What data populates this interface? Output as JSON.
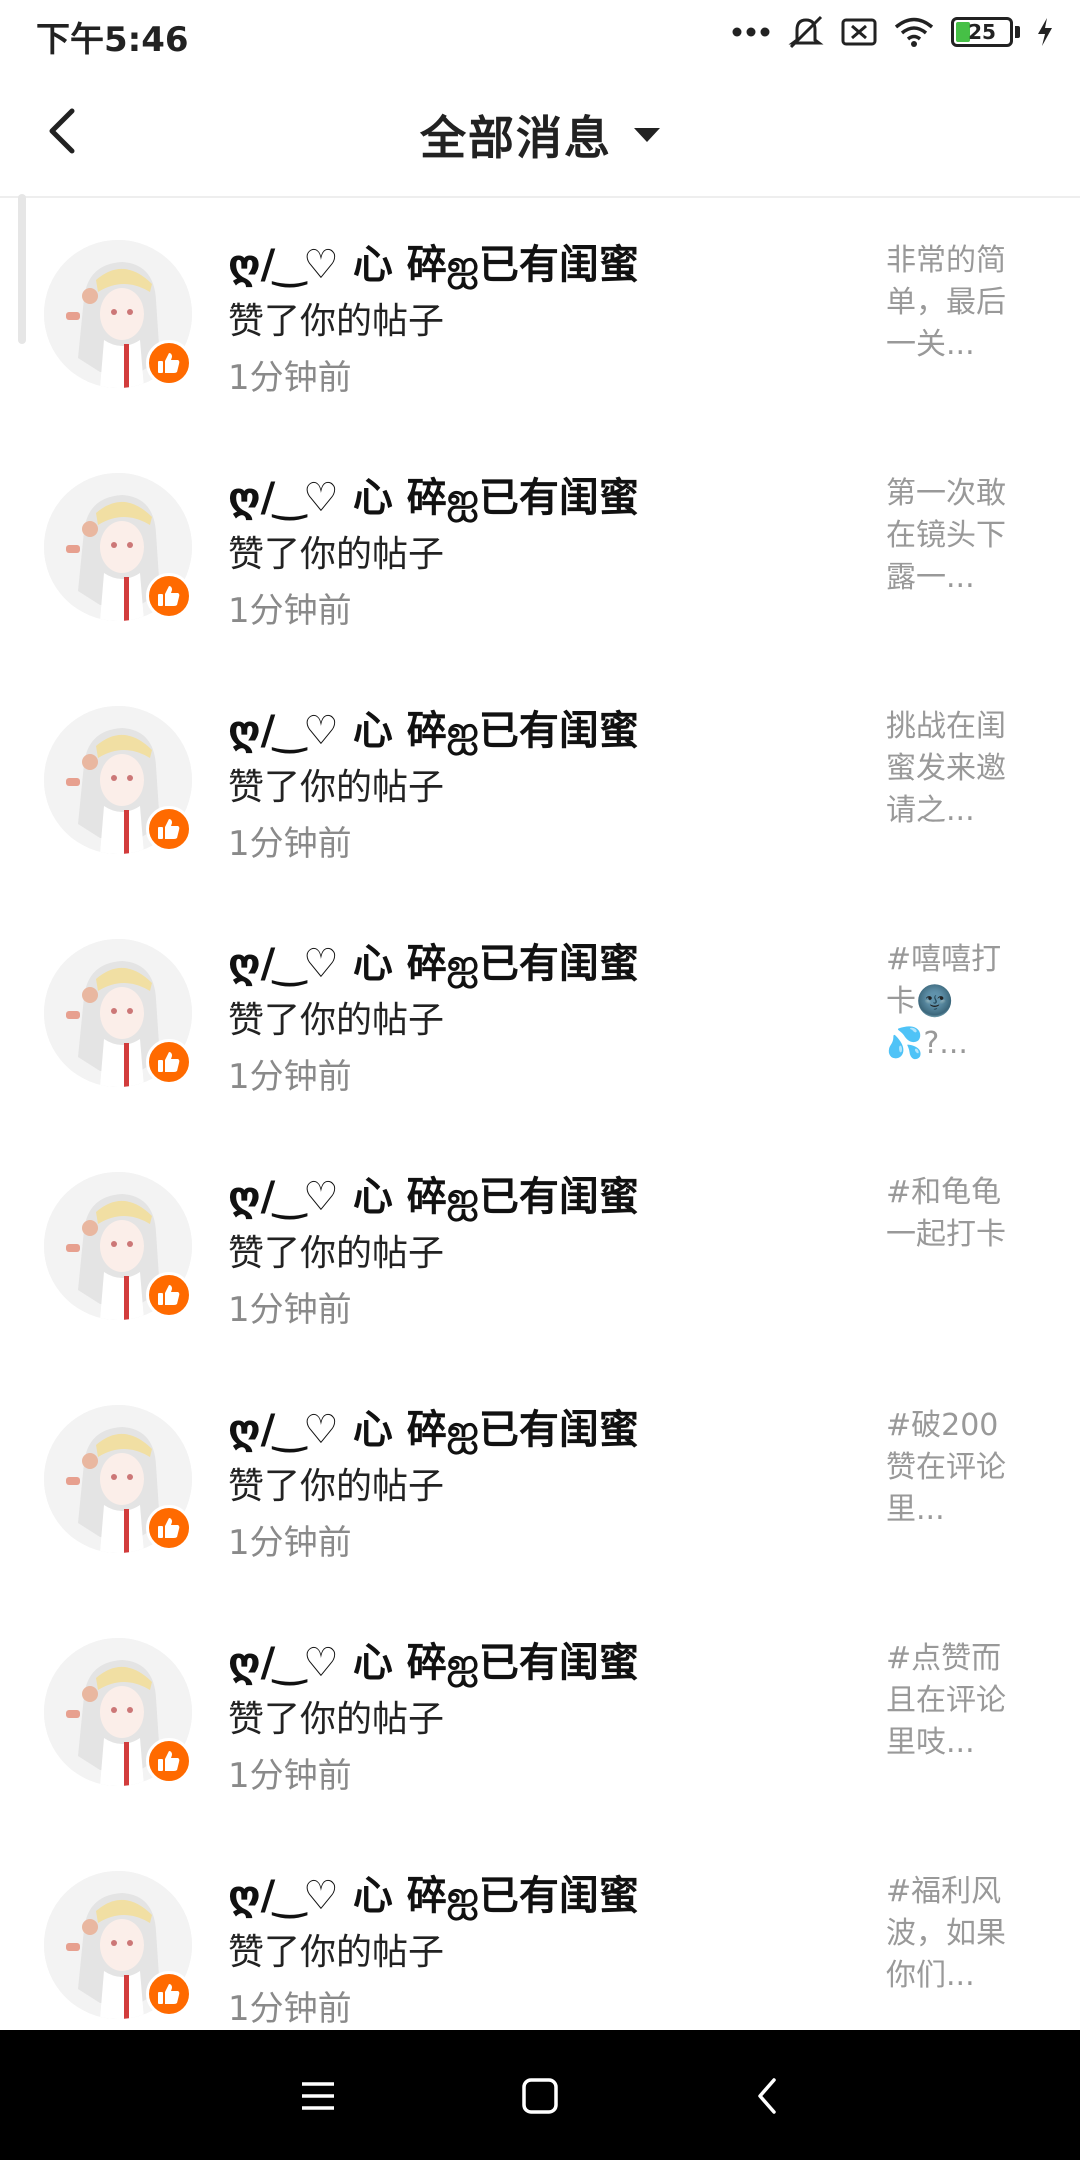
{
  "status_bar": {
    "time": "下午5:46",
    "battery": "25",
    "battery_level": 0.25,
    "icons": [
      "more-dots-icon",
      "mute-icon",
      "no-sim-icon",
      "wifi-icon",
      "battery-icon",
      "charging-icon"
    ]
  },
  "header": {
    "title": "全部消息",
    "back_icon": "back-icon",
    "dropdown_icon": "caret-down-icon"
  },
  "notifications": [
    {
      "name": "ღ/ ͜ ♡ 心 碎ஐ已有闺蜜",
      "action": "赞了你的帖子",
      "time": "1分钟前",
      "preview": "非常的简单，最后一关..."
    },
    {
      "name": "ღ/ ͜ ♡ 心 碎ஐ已有闺蜜",
      "action": "赞了你的帖子",
      "time": "1分钟前",
      "preview": "第一次敢在镜头下露一..."
    },
    {
      "name": "ღ/ ͜ ♡ 心 碎ஐ已有闺蜜",
      "action": "赞了你的帖子",
      "time": "1分钟前",
      "preview": "挑战在闺蜜发来邀请之..."
    },
    {
      "name": "ღ/ ͜ ♡ 心 碎ஐ已有闺蜜",
      "action": "赞了你的帖子",
      "time": "1分钟前",
      "preview": "#嘻嘻打卡🌚💦?..."
    },
    {
      "name": "ღ/ ͜ ♡ 心 碎ஐ已有闺蜜",
      "action": "赞了你的帖子",
      "time": "1分钟前",
      "preview": "#和龟龟一起打卡"
    },
    {
      "name": "ღ/ ͜ ♡ 心 碎ஐ已有闺蜜",
      "action": "赞了你的帖子",
      "time": "1分钟前",
      "preview": "#破200赞在评论里..."
    },
    {
      "name": "ღ/ ͜ ♡ 心 碎ஐ已有闺蜜",
      "action": "赞了你的帖子",
      "time": "1分钟前",
      "preview": "#点赞而且在评论里吱..."
    },
    {
      "name": "ღ/ ͜ ♡ 心 碎ஐ已有闺蜜",
      "action": "赞了你的帖子",
      "time": "1分钟前",
      "preview": "#福利风波，如果你们..."
    }
  ],
  "nav_bar": {
    "icons": [
      "menu-icon",
      "home-icon",
      "back-icon"
    ]
  },
  "colors": {
    "badge": "#ff6a00",
    "secondary_text": "#8a8a8a",
    "preview_text": "#999999",
    "nav_background": "#000000"
  }
}
